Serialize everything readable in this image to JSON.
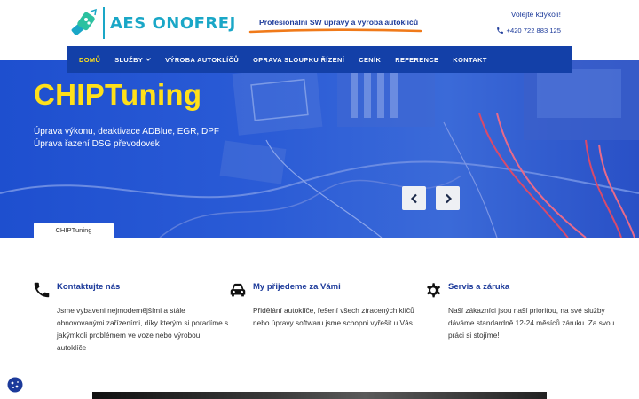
{
  "header": {
    "logo_text": "AES ONOFREJ",
    "tagline": "Profesionální SW úpravy a výroba autoklíčů",
    "call_text": "Volejte kdykoli!",
    "phone": "+420 722 883 125"
  },
  "nav": {
    "items": [
      {
        "label": "DOMŮ",
        "active": true
      },
      {
        "label": "SLUŽBY",
        "dropdown": true
      },
      {
        "label": "VÝROBA AUTOKLÍČŮ"
      },
      {
        "label": "OPRAVA SLOUPKU ŘÍZENÍ"
      },
      {
        "label": "CENÍK"
      },
      {
        "label": "REFERENCE"
      },
      {
        "label": "KONTAKT"
      }
    ]
  },
  "hero": {
    "title": "CHIPTuning",
    "line1": "Úprava výkonu, deaktivace ADBlue, EGR, DPF",
    "line2": "Úprava řazení DSG převodovek",
    "prev_icon": "chevron-left-icon",
    "next_icon": "chevron-right-icon",
    "tab_label": "CHIPTuning"
  },
  "features": [
    {
      "icon": "phone-icon",
      "title": "Kontaktujte nás",
      "text": "Jsme vybaveni nejmodernějšími a stále obnovovanými zařízeními, díky kterým si poradíme s jakýmkoli problémem ve voze nebo výrobou autoklíče"
    },
    {
      "icon": "car-icon",
      "title": "My přijedeme za Vámi",
      "text": "Přidělání autoklíče, řešení všech ztracených klíčů nebo úpravy softwaru jsme schopni vyřešit u Vás."
    },
    {
      "icon": "gear-icon",
      "title": "Servis a záruka",
      "text": "Naší zákazníci jsou naší prioritou, na své služby dáváme standardně 12-24 měsíců záruku. Za svou práci si stojíme!"
    }
  ],
  "colors": {
    "brand_blue": "#1340a8",
    "accent_yellow": "#ffe01a",
    "logo_teal": "#1aa7c7",
    "tagline_orange": "#f07a1a"
  }
}
